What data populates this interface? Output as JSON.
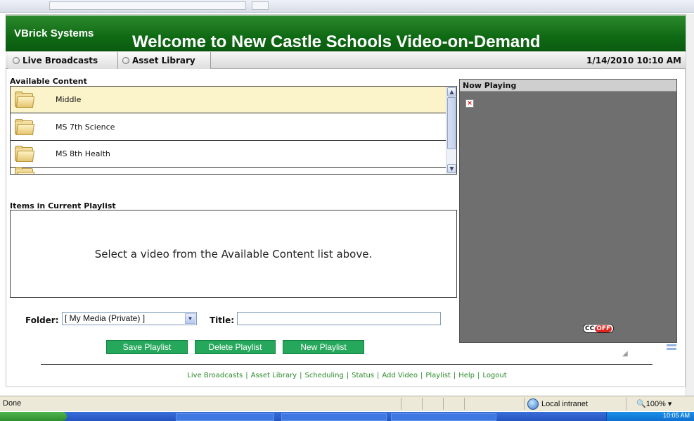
{
  "header": {
    "brand": "VBrick Systems",
    "welcome": "Welcome to New Castle Schools Video-on-Demand"
  },
  "nav": {
    "tabs": [
      {
        "label": "Live Broadcasts"
      },
      {
        "label": "Asset Library"
      }
    ],
    "datetime": "1/14/2010 10:10 AM"
  },
  "content": {
    "label": "Available Content",
    "items": [
      {
        "label": "Middle",
        "selected": true
      },
      {
        "label": "MS 7th Science",
        "selected": false
      },
      {
        "label": "MS 8th Health",
        "selected": false
      }
    ]
  },
  "playlist": {
    "label": "Items in Current Playlist",
    "message": "Select a video from the Available Content list above."
  },
  "form": {
    "folder_label": "Folder:",
    "folder_value": "[ My Media (Private) ]",
    "title_label": "Title:",
    "title_value": ""
  },
  "buttons": {
    "save": "Save Playlist",
    "delete": "Delete Playlist",
    "new": "New Playlist"
  },
  "footer": {
    "links": [
      "Live Broadcasts",
      "Asset Library",
      "Scheduling",
      "Status",
      "Add Video",
      "Playlist",
      "Help",
      "Logout"
    ],
    "separator": "|"
  },
  "now_playing": {
    "label": "Now Playing",
    "broken_image_glyph": "×",
    "cc_label": "CC",
    "cc_state": "OFF"
  },
  "status_bar": {
    "status": "Done",
    "zone": "Local intranet",
    "zoom": "100%"
  },
  "taskbar": {
    "clock": "10:05 AM"
  },
  "colors": {
    "header_green": "#0f6a14",
    "button_green": "#25a85b",
    "selected_row": "#fbf3c9",
    "player_bg": "#6f6f6f",
    "link_green": "#2a8a2a"
  }
}
